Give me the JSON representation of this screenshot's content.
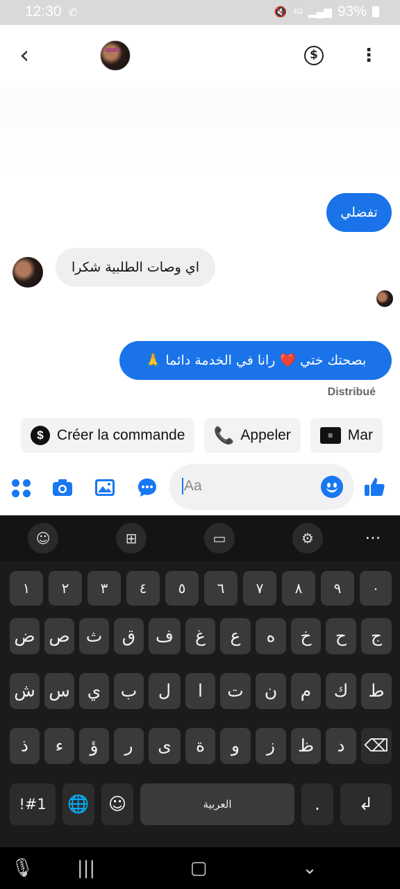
{
  "status_bar": {
    "time": "12:30",
    "battery": "93%",
    "network": "4G"
  },
  "header": {
    "back_icon": "chevron-left-icon",
    "payment_icon": "dollar-circle-icon",
    "more_icon": "more-vertical-icon"
  },
  "messages": [
    {
      "direction": "out",
      "text": "تفضلي"
    },
    {
      "direction": "in",
      "text": "اي وصات الطلبية شكرا"
    },
    {
      "direction": "out",
      "text": "بصحتك ختي ❤️ رانا في الخدمة دائما 🙏"
    }
  ],
  "delivery_status": "Distribué",
  "quick_actions": [
    {
      "label": "Créer la commande",
      "icon": "dollar-circle-icon"
    },
    {
      "label": "Appeler",
      "icon": "phone-icon"
    },
    {
      "label": "Mar",
      "icon": "contact-card-icon"
    }
  ],
  "composer": {
    "placeholder": "Aa"
  },
  "keyboard": {
    "number_row": [
      "١",
      "٢",
      "٣",
      "٤",
      "٥",
      "٦",
      "٧",
      "٨",
      "٩",
      "٠"
    ],
    "row1": [
      "ض",
      "ص",
      "ث",
      "ق",
      "ف",
      "غ",
      "ع",
      "ه",
      "خ",
      "ح",
      "ج"
    ],
    "row2": [
      "ش",
      "س",
      "ي",
      "ب",
      "ل",
      "ا",
      "ت",
      "ن",
      "م",
      "ك",
      "ط"
    ],
    "row3": [
      "ذ",
      "ء",
      "ؤ",
      "ر",
      "ى",
      "ة",
      "و",
      "ز",
      "ظ",
      "د"
    ],
    "symbols_key": "!#1",
    "space_label": "العربية",
    "period_key": "."
  },
  "colors": {
    "accent": "#1877f2",
    "outgoing_bubble": "#1a73e8",
    "incoming_bubble": "#efeff1",
    "keyboard_bg": "#1b1b1b"
  }
}
